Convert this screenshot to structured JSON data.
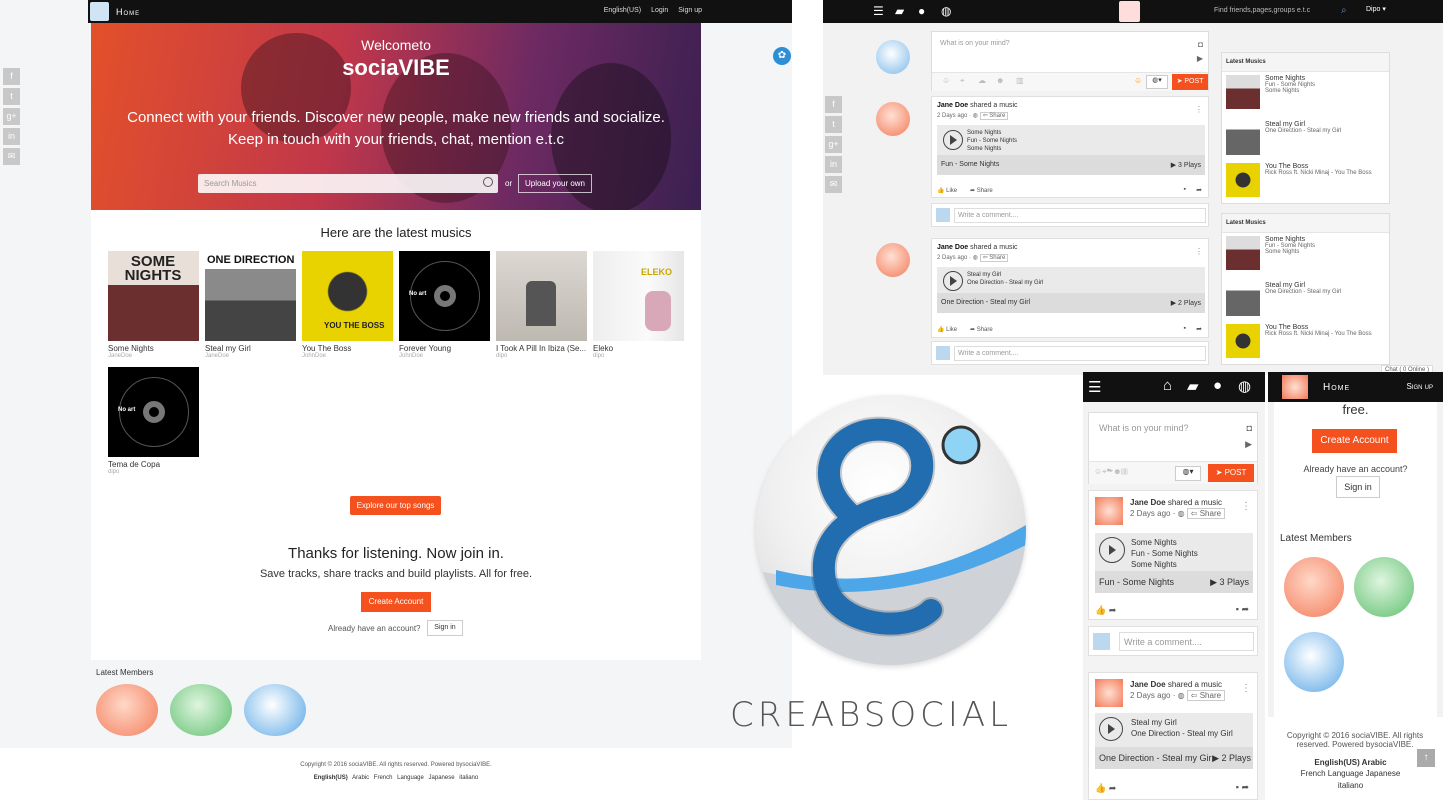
{
  "left": {
    "nav": {
      "home": "Home",
      "lang": "English(US)",
      "login": "Login",
      "signup": "Sign up"
    },
    "hero": {
      "welcome": "Welcometo",
      "brand": "sociaVIBE",
      "tagline1": "Connect with your friends. Discover new people, make new friends and socialize.",
      "tagline2": "Keep in touch with your friends, chat, mention e.t.c",
      "search_placeholder": "Search Musics",
      "or": "or",
      "upload": "Upload your own"
    },
    "latest_title": "Here are the latest musics",
    "albums": [
      {
        "title": "Some Nights",
        "artist": "JaneDoe",
        "art_text": "SOME NIGHTS"
      },
      {
        "title": "Steal my Girl",
        "artist": "JaneDoe",
        "art_text": "ONE DIRECTION"
      },
      {
        "title": "You The Boss",
        "artist": "JohnDoe",
        "art_text": "YOU THE BOSS"
      },
      {
        "title": "Forever Young",
        "artist": "JohnDoe",
        "art_text": "No art"
      },
      {
        "title": "I Took A Pill In Ibiza (Se...",
        "artist": "dipo",
        "art_text": ""
      },
      {
        "title": "Eleko",
        "artist": "dipo",
        "art_text": "ELEKO"
      },
      {
        "title": "Tema de Copa",
        "artist": "dipo",
        "art_text": "No art"
      }
    ],
    "explore": "Explore our top songs",
    "thanks": "Thanks for listening. Now join in.",
    "save": "Save tracks, share tracks and build playlists. All for free.",
    "create": "Create Account",
    "already": "Already have an account?",
    "signin": "Sign in",
    "members_title": "Latest Members",
    "copyright": "Copyright © 2016 sociaVIBE. All rights reserved. Powered bysociaVIBE.",
    "langs": [
      "English(US)",
      "Arabic",
      "French Language",
      "Japanese",
      "italiano"
    ]
  },
  "right": {
    "find": "Find friends,pages,groups e.t.c",
    "user": "Dipo",
    "status_placeholder": "What is on your mind?",
    "post": "POST",
    "posts": [
      {
        "name": "Jane Doe",
        "action": "shared a music",
        "time": "2 Days ago",
        "share": "Share",
        "lines": [
          "Some Nights",
          "Fun - Some Nights",
          "Some Nights"
        ],
        "track": "Fun - Some Nights",
        "plays": "3 Plays"
      },
      {
        "name": "Jane Doe",
        "action": "shared a music",
        "time": "2 Days ago",
        "share": "Share",
        "lines": [
          "Steal my Girl",
          "One Direction - Steal my Girl"
        ],
        "track": "One Direction - Steal my Girl",
        "plays": "2 Plays"
      }
    ],
    "like": "Like",
    "share": "Share",
    "comment_placeholder": "Write a comment....",
    "sidebar_title": "Latest Musics",
    "side_items": [
      {
        "title": "Some Nights",
        "sub1": "Fun - Some Nights",
        "sub2": "Some Nights"
      },
      {
        "title": "Steal my Girl",
        "sub1": "One Direction - Steal my Girl",
        "sub2": ""
      },
      {
        "title": "You The Boss",
        "sub1": "Rick Ross ft. Nicki Minaj - You The Boss",
        "sub2": ""
      }
    ],
    "chat": "Chat ( 0 Online )"
  },
  "mobile2": {
    "home": "Home",
    "signup": "Sign up",
    "free": "free.",
    "create": "Create Account",
    "already": "Already have an account?",
    "signin": "Sign in",
    "members": "Latest Members",
    "copyright": "Copyright © 2016 sociaVIBE. All rights reserved. Powered bysociaVIBE.",
    "langs1": "English(US)   Arabic",
    "langs2": "French Language   Japanese",
    "langs3": "italiano"
  },
  "brand_wordmark": "CREABSOCIAL",
  "colors": {
    "accent": "#f4511e",
    "dark": "#111111",
    "logo_blue": "#1e88e5"
  }
}
